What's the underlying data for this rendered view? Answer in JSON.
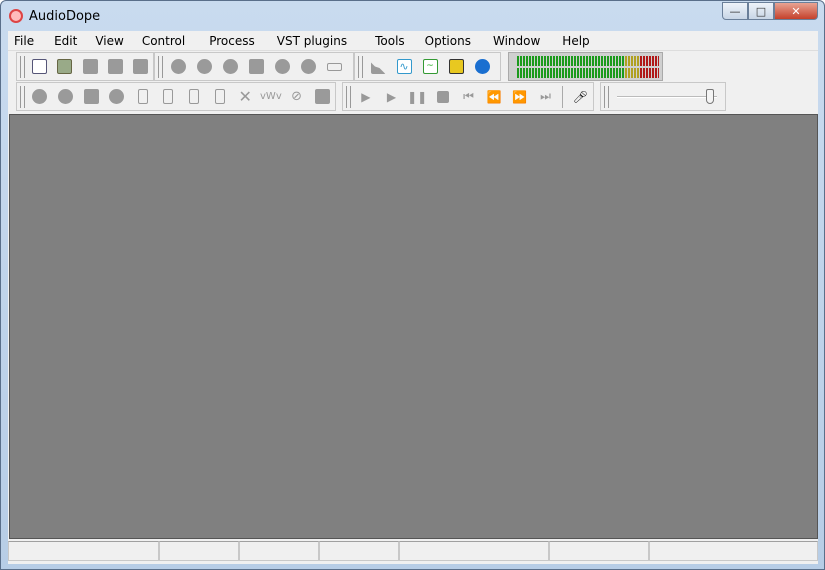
{
  "title": "AudioDope",
  "menu": [
    "File",
    "Edit",
    "View",
    "Control",
    "Process",
    "VST plugins",
    "Tools",
    "Options",
    "Window",
    "Help"
  ],
  "toolbar_file": [
    "new-file-icon",
    "open-file-icon",
    "folder-icon",
    "save-icon",
    "save-as-icon"
  ],
  "toolbar_zoom": [
    "zoom-in-horizontal-icon",
    "zoom-out-horizontal-icon",
    "zoom-selection-icon",
    "zoom-full-icon",
    "zoom-in-vertical-icon",
    "zoom-out-vertical-icon",
    "fit-width-icon"
  ],
  "toolbar_view": [
    "spectrum-icon",
    "waveform-icon",
    "pulse-icon",
    "cd-burn-icon",
    "audio-info-icon"
  ],
  "toolbar_edit": [
    "undo-icon",
    "redo-icon",
    "copy-icon",
    "cut-icon",
    "paste-new-icon",
    "paste-mix-icon",
    "paste-insert-icon",
    "paste-overwrite-icon",
    "delete-icon",
    "trim-icon",
    "silence-icon",
    "select-all-icon"
  ],
  "toolbar_transport": [
    "play-icon",
    "play-from-start-icon",
    "pause-icon",
    "stop-icon",
    "go-to-start-icon",
    "rewind-icon",
    "fast-forward-icon",
    "go-to-end-icon"
  ],
  "record_icon": "microphone-icon",
  "volume_level": 0.97,
  "meter_colors": {
    "green": "#1c9a1c",
    "yellow": "#b0a020",
    "red": "#b01818"
  },
  "status_sections": [
    "",
    "",
    "",
    "",
    "",
    "",
    ""
  ]
}
